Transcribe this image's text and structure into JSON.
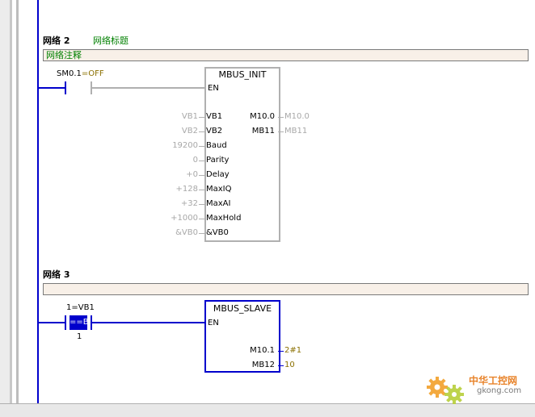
{
  "network2": {
    "title": "网络 2",
    "label": "网络标题",
    "comment": "网络注释",
    "contact_name": "SM0.1",
    "contact_state": "=OFF",
    "block": {
      "name": "MBUS_INIT",
      "en": "EN",
      "inputs": [
        {
          "pin": "VB1",
          "value": "VB1"
        },
        {
          "pin": "VB2",
          "value": "VB2"
        },
        {
          "pin": "Baud",
          "value": "19200"
        },
        {
          "pin": "Parity",
          "value": "0"
        },
        {
          "pin": "Delay",
          "value": "+0"
        },
        {
          "pin": "MaxIQ",
          "value": "+128"
        },
        {
          "pin": "MaxAI",
          "value": "+32"
        },
        {
          "pin": "MaxHold",
          "value": "+1000"
        },
        {
          "pin": "&VB0",
          "value": "&VB0"
        }
      ],
      "outputs": [
        {
          "pin": "M10.0",
          "value": "M10.0"
        },
        {
          "pin": "MB11",
          "value": "MB11"
        }
      ]
    }
  },
  "network3": {
    "title": "网络 3",
    "comment": "",
    "contact_top": "1=VB1",
    "contact_op": "==B",
    "contact_bottom": "1",
    "block": {
      "name": "MBUS_SLAVE",
      "en": "EN",
      "outputs": [
        {
          "pin": "M10.1",
          "value": "2#1"
        },
        {
          "pin": "MB12",
          "value": "10"
        }
      ]
    }
  },
  "watermark": {
    "brand": "中华工控网",
    "url": "gkong.com"
  },
  "colors": {
    "rail": "#0000cc",
    "inactive": "#b0b0b0",
    "comment_bg": "#f8f0e8",
    "label_green": "#008000",
    "value_olive": "#8b7000"
  }
}
